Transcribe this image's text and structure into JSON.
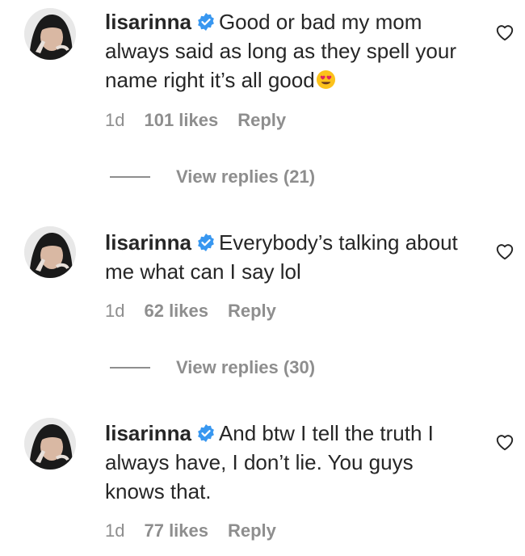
{
  "comments": [
    {
      "username": "lisarinna",
      "text": "Good or bad my mom always said as long as they spell your name right it’s all good",
      "emoji": "heart-eyes-emoji",
      "time": "1d",
      "likes": "101 likes",
      "reply": "Reply",
      "view_replies": "View replies (21)"
    },
    {
      "username": "lisarinna",
      "text": "Everybody’s talking about me what can I say lol",
      "time": "1d",
      "likes": "62 likes",
      "reply": "Reply",
      "view_replies": "View replies (30)"
    },
    {
      "username": "lisarinna",
      "text": "And btw I tell the truth I always have, I don’t lie. You guys knows that.",
      "time": "1d",
      "likes": "77 likes",
      "reply": "Reply"
    }
  ],
  "colors": {
    "text": "#262626",
    "secondary": "#8e8e8e",
    "verified": "#3897f0"
  },
  "icons": [
    "verified-badge-icon",
    "heart-icon",
    "heart-eyes-emoji"
  ]
}
